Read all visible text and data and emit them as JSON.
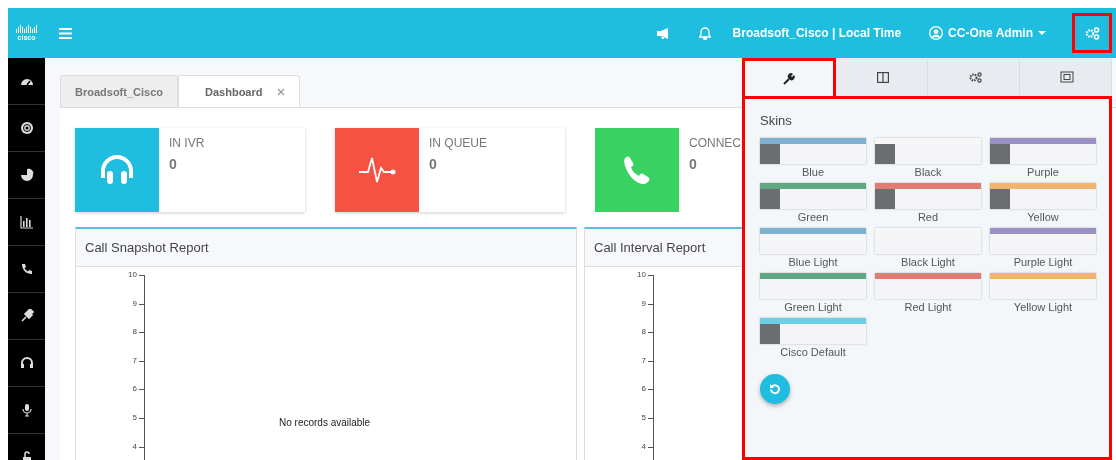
{
  "header": {
    "logo_text": "cisco",
    "location": "Broadsoft_Cisco | Local Time",
    "user": "CC-One Admin",
    "settings_highlighted": true
  },
  "tabs": [
    {
      "label": "Broadsoft_Cisco",
      "selected": false,
      "closable": false
    },
    {
      "label": "Dashboard",
      "selected": true,
      "closable": true
    }
  ],
  "stats": [
    {
      "kind": "headset",
      "label": "IN IVR",
      "value": "0",
      "color": "#1fbde0"
    },
    {
      "kind": "pulse",
      "label": "IN QUEUE",
      "value": "0",
      "color": "#f55244"
    },
    {
      "kind": "phone",
      "label": "CONNEC",
      "value": "0",
      "color": "#3ad163"
    }
  ],
  "reports": [
    {
      "title": "Call Snapshot Report",
      "y_ticks": [
        "10",
        "9",
        "8",
        "7",
        "6",
        "5",
        "4"
      ],
      "empty_message": "No records available"
    },
    {
      "title": "Call Interval Report",
      "y_ticks": [
        "10",
        "9",
        "8",
        "7",
        "6",
        "5",
        "4"
      ]
    }
  ],
  "settings_panel": {
    "highlighted": true,
    "tabs": [
      {
        "kind": "wrench",
        "selected": true,
        "highlighted": true
      },
      {
        "kind": "columns",
        "selected": false,
        "highlighted": false
      },
      {
        "kind": "gears",
        "selected": false,
        "highlighted": false
      },
      {
        "kind": "frame",
        "selected": false,
        "highlighted": false
      }
    ],
    "title": "Skins",
    "skins": [
      {
        "name": "Blue",
        "color": "#7eb0d0",
        "dark_sidebar": true
      },
      {
        "name": "Black",
        "color": "#f7f7f7",
        "dark_sidebar": true
      },
      {
        "name": "Purple",
        "color": "#9b90c4",
        "dark_sidebar": true
      },
      {
        "name": "Green",
        "color": "#5fa883",
        "dark_sidebar": true
      },
      {
        "name": "Red",
        "color": "#e07c74",
        "dark_sidebar": true
      },
      {
        "name": "Yellow",
        "color": "#f1b46e",
        "dark_sidebar": true
      },
      {
        "name": "Blue Light",
        "color": "#7eb0d0",
        "dark_sidebar": false
      },
      {
        "name": "Black Light",
        "color": "#f7f7f7",
        "dark_sidebar": false
      },
      {
        "name": "Purple Light",
        "color": "#9b90c4",
        "dark_sidebar": false
      },
      {
        "name": "Green Light",
        "color": "#5fa883",
        "dark_sidebar": false
      },
      {
        "name": "Red Light",
        "color": "#e07c74",
        "dark_sidebar": false
      },
      {
        "name": "Yellow Light",
        "color": "#f1b46e",
        "dark_sidebar": false
      },
      {
        "name": "Cisco Default",
        "color": "#6ccfe6",
        "dark_sidebar": true
      }
    ]
  }
}
